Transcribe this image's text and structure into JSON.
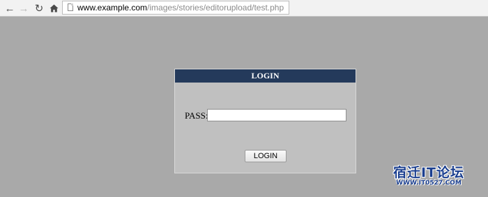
{
  "browser": {
    "url_host": "www.example.com",
    "url_path": "/images/stories/editorupload/test.php",
    "icons": {
      "back": "back-arrow-icon",
      "forward": "forward-arrow-icon",
      "reload": "reload-icon",
      "home": "home-icon",
      "page": "page-icon"
    }
  },
  "login": {
    "title": "LOGIN",
    "pass_label": "PASS:",
    "pass_value": "",
    "button_label": "LOGIN",
    "header_color": "#243a5b",
    "panel_color": "#c0c0c0"
  },
  "page": {
    "background_color": "#a9a9a9"
  },
  "watermark": {
    "text_cn": "宿迁IT论坛",
    "url": "WWW.IT0527.COM"
  }
}
